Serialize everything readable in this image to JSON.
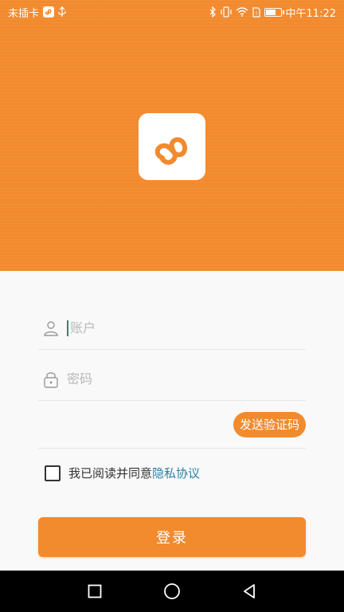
{
  "status_bar": {
    "carrier": "未插卡",
    "time": "中午11:22",
    "icons": [
      "app-logo-icon",
      "usb-icon",
      "bluetooth-icon",
      "vibrate-icon",
      "wifi-icon",
      "sim-icon",
      "battery-icon"
    ]
  },
  "form": {
    "account_placeholder": "账户",
    "password_placeholder": "密码",
    "send_code_label": "发送验证码"
  },
  "agreement": {
    "text": "我已阅读并同意",
    "link": "隐私协议",
    "checked": false
  },
  "login_label": "登录",
  "colors": {
    "brand": "#f28a2e",
    "link": "#2d7fa6"
  }
}
